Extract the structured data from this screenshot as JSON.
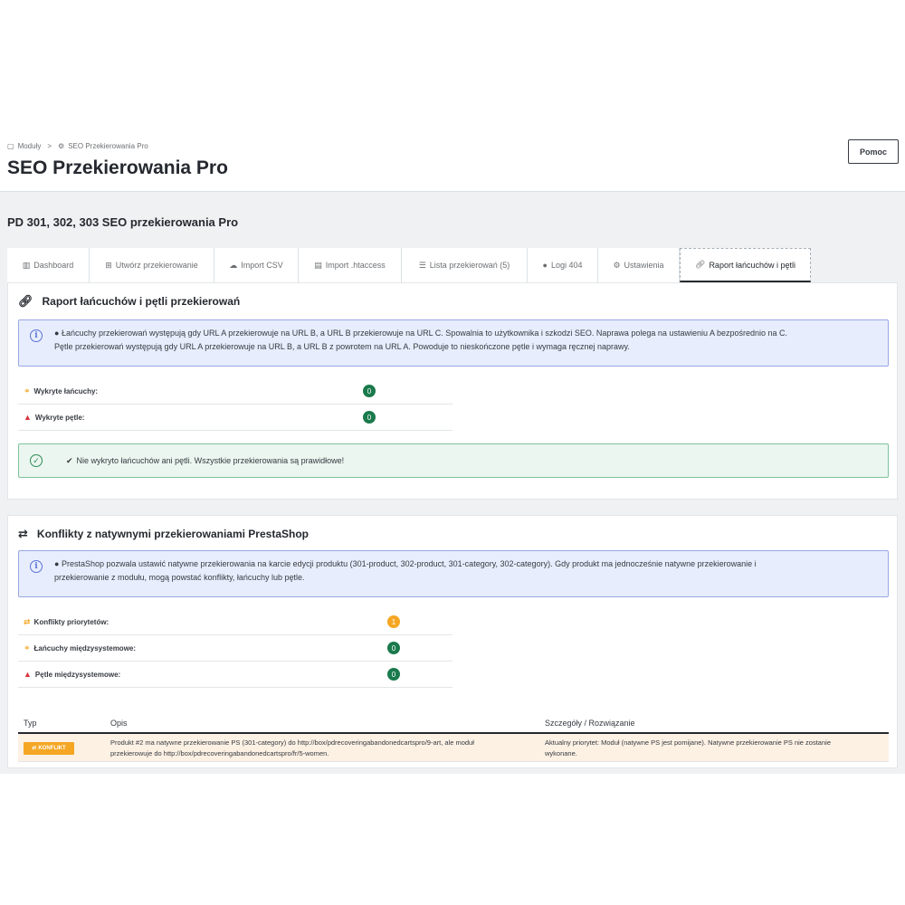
{
  "breadcrumb": {
    "item1": "Moduły",
    "separator": ">",
    "item2": "SEO Przekierowania Pro"
  },
  "page_title": "SEO Przekierowania Pro",
  "help_button": "Pomoc",
  "module_title": "PD 301, 302, 303 SEO przekierowania Pro",
  "tabs": [
    {
      "label": "Dashboard",
      "icon": "bar-chart-icon"
    },
    {
      "label": "Utwórz przekierowanie",
      "icon": "plus-square-icon"
    },
    {
      "label": "Import CSV",
      "icon": "cloud-upload-icon"
    },
    {
      "label": "Import .htaccess",
      "icon": "file-icon"
    },
    {
      "label": "Lista przekierowań (5)",
      "icon": "list-icon"
    },
    {
      "label": "Logi 404",
      "icon": "info-circle-icon"
    },
    {
      "label": "Ustawienia",
      "icon": "gears-icon"
    },
    {
      "label": "Raport łańcuchów i pętli",
      "icon": "link-icon"
    }
  ],
  "active_tab": "Raport łańcuchów i pętli",
  "report": {
    "title": "Raport łańcuchów i pętli przekierowań",
    "info_line1": "Łańcuchy przekierowań występują gdy URL A przekierowuje na URL B, a URL B przekierowuje na URL C. Spowalnia to użytkownika i szkodzi SEO. Naprawa polega na ustawieniu A bezpośrednio na C.",
    "info_line2": "Pętle przekierowań występują gdy URL A przekierowuje na URL B, a URL B z powrotem na URL A. Powoduje to nieskończone pętle i wymaga ręcznej naprawy.",
    "stats": [
      {
        "label": "Wykryte łańcuchy:",
        "value": "0"
      },
      {
        "label": "Wykryte pętle:",
        "value": "0"
      }
    ],
    "success": "Nie wykryto łańcuchów ani pętli. Wszystkie przekierowania są prawidłowe!"
  },
  "conflicts": {
    "title": "Konflikty z natywnymi przekierowaniami PrestaShop",
    "info_line1": "PrestaShop pozwala ustawić natywne przekierowania na karcie edycji produktu (301-product, 302-product, 301-category, 302-category). Gdy produkt ma jednocześnie natywne przekierowanie i",
    "info_line2": "przekierowanie z modułu, mogą powstać konflikty, łańcuchy lub pętle.",
    "stats": [
      {
        "label": "Konflikty priorytetów:",
        "value": "1"
      },
      {
        "label": "Łańcuchy międzysystemowe:",
        "value": "0"
      },
      {
        "label": "Pętle międzysystemowe:",
        "value": "0"
      }
    ],
    "table": {
      "headers": {
        "type": "Typ",
        "desc": "Opis",
        "details": "Szczegóły / Rozwiązanie"
      },
      "rows": [
        {
          "type": "KONFLIKT",
          "desc_line1": "Produkt #2 ma natywne przekierowanie PS (301-category) do http://box/pdrecoveringabandonedcartspro/9-art, ale moduł",
          "desc_line2": "przekierowuje do http://box/pdrecoveringabandonedcartspro/fr/5-women.",
          "details_line1": "Aktualny priorytet: Moduł (natywne PS jest pomijane). Natywne przekierowanie PS nie zostanie",
          "details_line2": "wykonane."
        }
      ]
    }
  },
  "colors": {
    "success_badge": "#1a7a4c",
    "warning_badge": "#f5a623",
    "info_bg": "#e8edfd",
    "success_bg": "#eaf6ef",
    "conflict_row_bg": "#fdf1e4"
  }
}
